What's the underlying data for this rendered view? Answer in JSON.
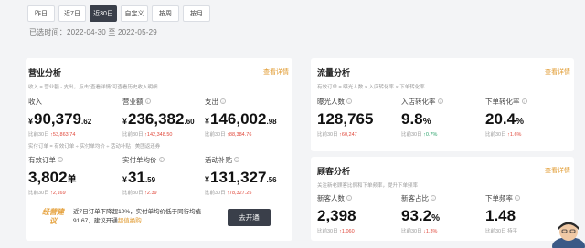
{
  "tabs": [
    "昨日",
    "近7日",
    "近30日",
    "自定义",
    "按周",
    "按月"
  ],
  "active_tab": 2,
  "range_label": "已选时间：2022-04-30 至 2022-05-29",
  "business": {
    "title": "营业分析",
    "link": "查看详情",
    "desc1": "收入 = 营业额 - 支出，点击\"查看详情\"可查看历史收入明细",
    "desc2": "实付订单 = 有效订单 ÷ 实付单均价 ÷ 活动补贴 · 美团返还券",
    "metrics": [
      {
        "label": "收入",
        "currency": "¥",
        "int": "90,379",
        "dec": ".62",
        "cmp_prefix": "比前30日",
        "arrow": "↑",
        "cmp": "53,863.74"
      },
      {
        "label": "营业额",
        "currency": "¥",
        "int": "236,382",
        "dec": ".60",
        "cmp_prefix": "比前30日",
        "arrow": "↑",
        "cmp": "142,348.50"
      },
      {
        "label": "支出",
        "currency": "¥",
        "int": "146,002",
        "dec": ".98",
        "cmp_prefix": "比前30日",
        "arrow": "↑",
        "cmp": "88,384.76"
      },
      {
        "label": "有效订单",
        "int": "3,802",
        "unit": "单",
        "cmp_prefix": "比前30日",
        "arrow": "↑",
        "cmp": "2,169"
      },
      {
        "label": "实付单均价",
        "currency": "¥",
        "int": "31",
        "dec": ".59",
        "cmp_prefix": "比前30日",
        "arrow": "↑",
        "cmp": "2.39"
      },
      {
        "label": "活动补贴",
        "currency": "¥",
        "int": "131,327",
        "dec": ".56",
        "cmp_prefix": "比前30日",
        "arrow": "↑",
        "cmp": "78,327.25"
      }
    ]
  },
  "flow": {
    "title": "流量分析",
    "link": "查看详情",
    "desc": "有效订单 = 曝光人数 × 入店转化率 × 下单转化率",
    "metrics": [
      {
        "label": "曝光人数",
        "value": "128,765",
        "cmp_prefix": "比前30日",
        "arrow": "↑",
        "cmp": "60,247"
      },
      {
        "label": "入店转化率",
        "value": "9.8",
        "unit": "%",
        "cmp_prefix": "比前30日",
        "arrow": "↑",
        "cmp": "0.7%"
      },
      {
        "label": "下单转化率",
        "value": "20.4",
        "unit": "%",
        "cmp_prefix": "比前30日",
        "arrow": "↑",
        "cmp": "1.6%"
      }
    ]
  },
  "customer": {
    "title": "顾客分析",
    "link": "查看详情",
    "desc": "关注新老顾客比例和下单频率，提升下单频率",
    "metrics": [
      {
        "label": "新客人数",
        "value": "2,398",
        "cmp_prefix": "比前30日",
        "arrow": "↑",
        "cmp": "1,060"
      },
      {
        "label": "新客占比",
        "value": "93.2",
        "unit": "%",
        "cmp_prefix": "比前30日",
        "arrow": "↓",
        "cmp": "1.3%"
      },
      {
        "label": "下单频率",
        "value": "1.48",
        "cmp_prefix": "比前30日 持平",
        "arrow": "",
        "cmp": ""
      }
    ]
  },
  "promo": {
    "logo": "经营建议",
    "line1": "近7日订单下降超10%，实付单均价低于同行均值",
    "line2_pre": "91.67，建议开通",
    "line2_hl": "超值换购",
    "button": "去开通"
  },
  "colors": {
    "accent": "#e19a2f",
    "up": "#e0473a",
    "up_green": "#2ba36b",
    "dark": "#3a3f4a"
  }
}
